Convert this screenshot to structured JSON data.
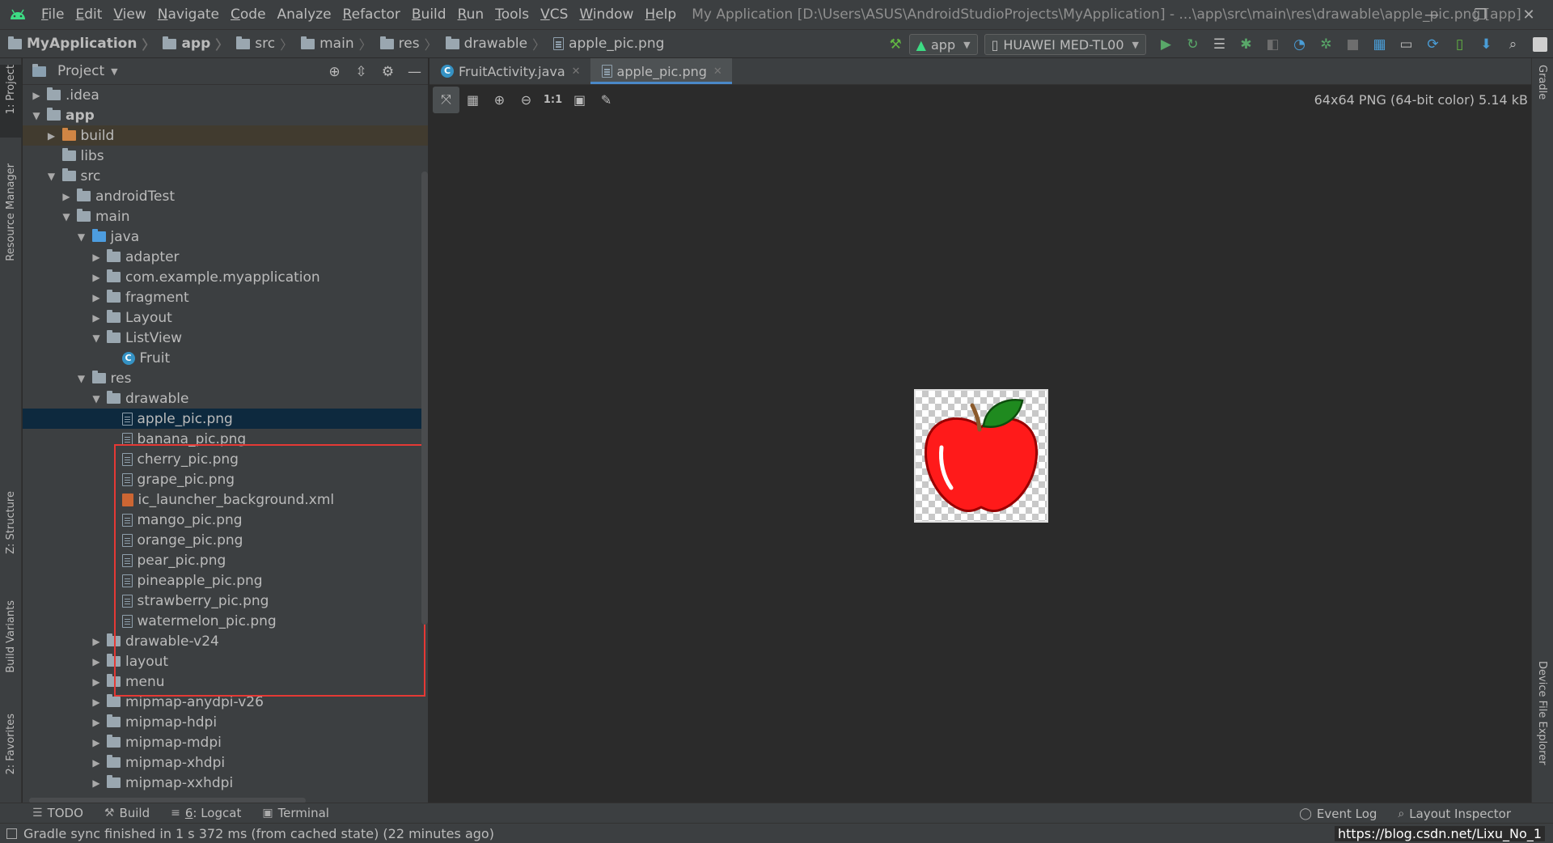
{
  "menubar": {
    "items": [
      {
        "mn": "F",
        "rest": "ile"
      },
      {
        "mn": "E",
        "rest": "dit"
      },
      {
        "mn": "V",
        "rest": "iew"
      },
      {
        "mn": "N",
        "rest": "avigate"
      },
      {
        "mn": "C",
        "rest": "ode"
      },
      {
        "mn": "",
        "rest": "Analyze"
      },
      {
        "mn": "R",
        "rest": "efactor"
      },
      {
        "mn": "B",
        "rest": "uild"
      },
      {
        "mn": "R",
        "rest": "un"
      },
      {
        "mn": "T",
        "rest": "ools"
      },
      {
        "mn": "V",
        "rest": "CS"
      },
      {
        "mn": "W",
        "rest": "indow"
      },
      {
        "mn": "H",
        "rest": "elp"
      }
    ],
    "window_title": "My Application [D:\\Users\\ASUS\\AndroidStudioProjects\\MyApplication] - ...\\app\\src\\main\\res\\drawable\\apple_pic.png [app]"
  },
  "breadcrumb": [
    "MyApplication",
    "app",
    "src",
    "main",
    "res",
    "drawable",
    "apple_pic.png"
  ],
  "run_toolbar": {
    "config": "app",
    "device": "HUAWEI MED-TL00"
  },
  "project_panel": {
    "title": "Project"
  },
  "tree": [
    {
      "label": ".idea",
      "depth": 0,
      "arrow": "▶",
      "icon": "folder"
    },
    {
      "label": "app",
      "depth": 0,
      "arrow": "▼",
      "icon": "module",
      "bold": true
    },
    {
      "label": "build",
      "depth": 1,
      "arrow": "▶",
      "icon": "orange",
      "hl": true
    },
    {
      "label": "libs",
      "depth": 1,
      "arrow": "",
      "icon": "folder"
    },
    {
      "label": "src",
      "depth": 1,
      "arrow": "▼",
      "icon": "folder"
    },
    {
      "label": "androidTest",
      "depth": 2,
      "arrow": "▶",
      "icon": "folder"
    },
    {
      "label": "main",
      "depth": 2,
      "arrow": "▼",
      "icon": "folder"
    },
    {
      "label": "java",
      "depth": 3,
      "arrow": "▼",
      "icon": "blue"
    },
    {
      "label": "adapter",
      "depth": 4,
      "arrow": "▶",
      "icon": "folder"
    },
    {
      "label": "com.example.myapplication",
      "depth": 4,
      "arrow": "▶",
      "icon": "folder"
    },
    {
      "label": "fragment",
      "depth": 4,
      "arrow": "▶",
      "icon": "folder"
    },
    {
      "label": "Layout",
      "depth": 4,
      "arrow": "▶",
      "icon": "folder"
    },
    {
      "label": "ListView",
      "depth": 4,
      "arrow": "▼",
      "icon": "folder"
    },
    {
      "label": "Fruit",
      "depth": 5,
      "arrow": "",
      "icon": "class"
    },
    {
      "label": "res",
      "depth": 3,
      "arrow": "▼",
      "icon": "folder"
    },
    {
      "label": "drawable",
      "depth": 4,
      "arrow": "▼",
      "icon": "folder"
    },
    {
      "label": "apple_pic.png",
      "depth": 5,
      "arrow": "",
      "icon": "file",
      "selected": true
    },
    {
      "label": "banana_pic.png",
      "depth": 5,
      "arrow": "",
      "icon": "file"
    },
    {
      "label": "cherry_pic.png",
      "depth": 5,
      "arrow": "",
      "icon": "file"
    },
    {
      "label": "grape_pic.png",
      "depth": 5,
      "arrow": "",
      "icon": "file"
    },
    {
      "label": "ic_launcher_background.xml",
      "depth": 5,
      "arrow": "",
      "icon": "xml"
    },
    {
      "label": "mango_pic.png",
      "depth": 5,
      "arrow": "",
      "icon": "file"
    },
    {
      "label": "orange_pic.png",
      "depth": 5,
      "arrow": "",
      "icon": "file"
    },
    {
      "label": "pear_pic.png",
      "depth": 5,
      "arrow": "",
      "icon": "file"
    },
    {
      "label": "pineapple_pic.png",
      "depth": 5,
      "arrow": "",
      "icon": "file"
    },
    {
      "label": "strawberry_pic.png",
      "depth": 5,
      "arrow": "",
      "icon": "file"
    },
    {
      "label": "watermelon_pic.png",
      "depth": 5,
      "arrow": "",
      "icon": "file"
    },
    {
      "label": "drawable-v24",
      "depth": 4,
      "arrow": "▶",
      "icon": "folder"
    },
    {
      "label": "layout",
      "depth": 4,
      "arrow": "▶",
      "icon": "folder"
    },
    {
      "label": "menu",
      "depth": 4,
      "arrow": "▶",
      "icon": "folder"
    },
    {
      "label": "mipmap-anydpi-v26",
      "depth": 4,
      "arrow": "▶",
      "icon": "folder"
    },
    {
      "label": "mipmap-hdpi",
      "depth": 4,
      "arrow": "▶",
      "icon": "folder"
    },
    {
      "label": "mipmap-mdpi",
      "depth": 4,
      "arrow": "▶",
      "icon": "folder"
    },
    {
      "label": "mipmap-xhdpi",
      "depth": 4,
      "arrow": "▶",
      "icon": "folder"
    },
    {
      "label": "mipmap-xxhdpi",
      "depth": 4,
      "arrow": "▶",
      "icon": "folder"
    }
  ],
  "editor": {
    "tabs": [
      {
        "label": "FruitActivity.java",
        "active": false
      },
      {
        "label": "apple_pic.png",
        "active": true
      }
    ],
    "image_info": "64x64 PNG (64-bit color) 5.14 kB"
  },
  "left_stripe": {
    "project": "1: Project",
    "resource_manager": "Resource Manager",
    "structure": "Z: Structure",
    "build_variants": "Build Variants",
    "favorites": "2: Favorites"
  },
  "right_stripe": {
    "gradle": "Gradle",
    "device_file_explorer": "Device File Explorer"
  },
  "bottom_tabs": {
    "todo": "TODO",
    "build": "Build",
    "logcat_mn": "6",
    "logcat_rest": ": Logcat",
    "terminal": "Terminal",
    "event_log": "Event Log",
    "layout_inspector": "Layout Inspector"
  },
  "status": {
    "message": "Gradle sync finished in 1 s 372 ms (from cached state) (22 minutes ago)",
    "watermark": "https://blog.csdn.net/Lixu_No_1"
  },
  "colors": {
    "accent": "#4a88c7",
    "selection": "#0d293e",
    "annotation_box": "#e53935"
  }
}
